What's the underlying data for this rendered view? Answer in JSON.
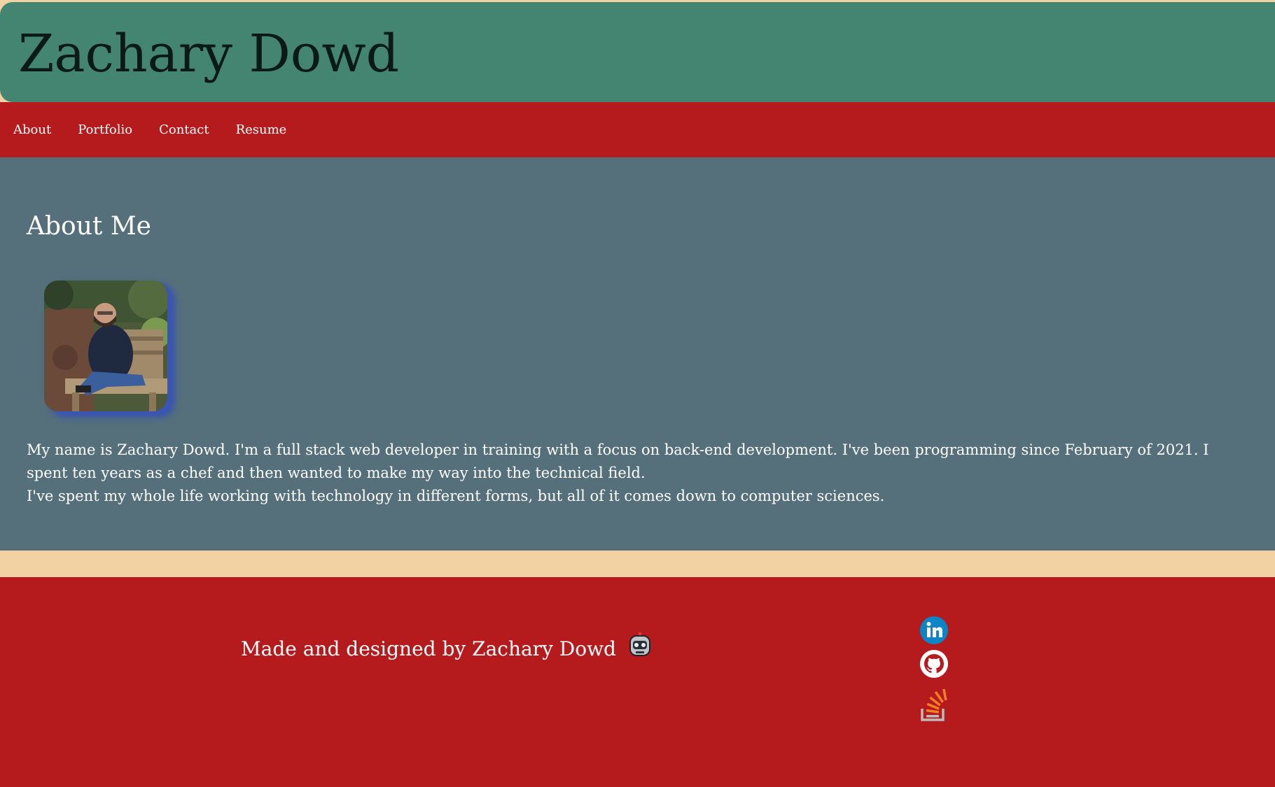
{
  "header": {
    "title": "Zachary Dowd"
  },
  "nav": {
    "items": [
      {
        "label": "About"
      },
      {
        "label": "Portfolio"
      },
      {
        "label": "Contact"
      },
      {
        "label": "Resume"
      }
    ]
  },
  "about": {
    "heading": "About Me",
    "paragraph1": "My name is Zachary Dowd. I'm a full stack web developer in training with a focus on back-end development. I've been programming since February of 2021. I spent ten years as a chef and then wanted to make my way into the technical field.",
    "paragraph2": "I've spent my whole life working with technology in different forms, but all of it comes down to computer sciences."
  },
  "footer": {
    "credit": "Made and designed by Zachary Dowd",
    "credit_icon": "robot-icon",
    "social": [
      {
        "icon": "linkedin-icon"
      },
      {
        "icon": "github-icon"
      },
      {
        "icon": "stackoverflow-icon"
      }
    ]
  },
  "colors": {
    "background": "#f2d1a3",
    "header": "#438570",
    "nav": "#b51b1c",
    "about": "#56707b",
    "footer": "#b51b1c",
    "text_light": "#ffffff",
    "title_text": "#0b1a16"
  }
}
